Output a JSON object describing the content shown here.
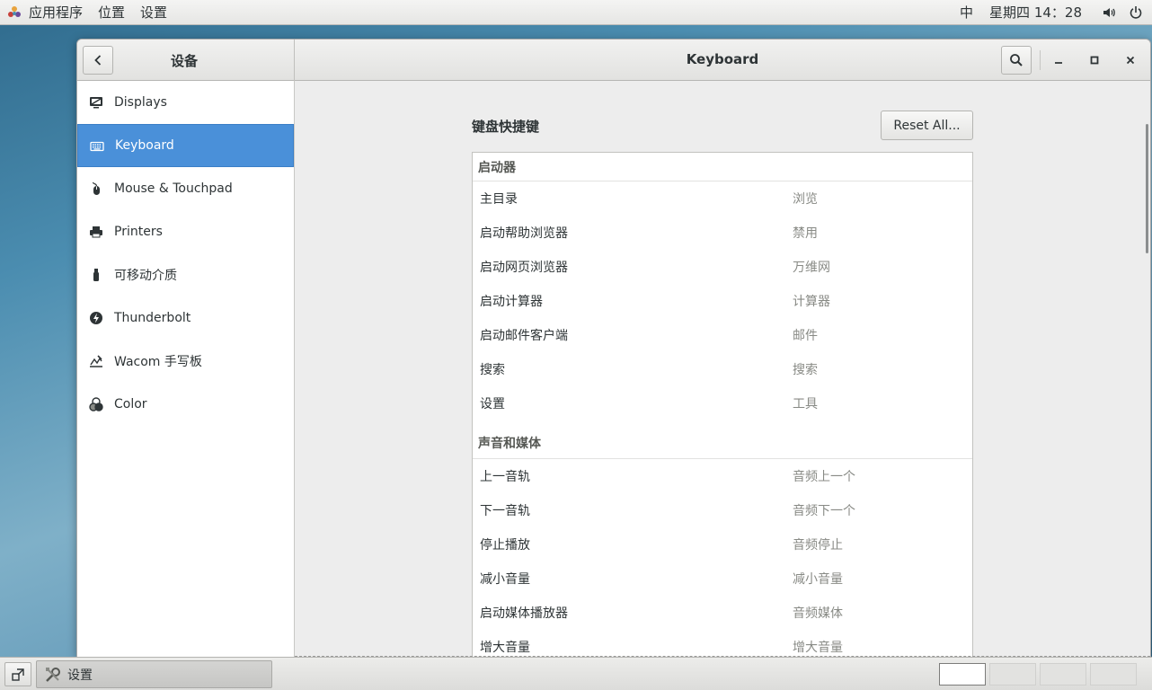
{
  "topbar": {
    "apps_menu": "应用程序",
    "places_menu": "位置",
    "settings_menu": "设置",
    "input_method": "中",
    "datetime": "星期四 14：28"
  },
  "window": {
    "sidebar_title": "设备",
    "page_title": "Keyboard"
  },
  "sidebar": {
    "items": [
      {
        "label": "Displays",
        "icon": "display-icon"
      },
      {
        "label": "Keyboard",
        "icon": "keyboard-icon",
        "active": true
      },
      {
        "label": "Mouse & Touchpad",
        "icon": "mouse-icon"
      },
      {
        "label": "Printers",
        "icon": "printer-icon"
      },
      {
        "label": "可移动介质",
        "icon": "usb-media-icon"
      },
      {
        "label": "Thunderbolt",
        "icon": "thunderbolt-icon"
      },
      {
        "label": "Wacom 手写板",
        "icon": "tablet-icon"
      },
      {
        "label": "Color",
        "icon": "color-icon"
      }
    ]
  },
  "shortcuts": {
    "section_title": "键盘快捷键",
    "reset_button": "Reset All...",
    "groups": [
      {
        "name": "启动器",
        "rows": [
          {
            "action": "主目录",
            "shortcut": "浏览"
          },
          {
            "action": "启动帮助浏览器",
            "shortcut": "禁用"
          },
          {
            "action": "启动网页浏览器",
            "shortcut": "万维网"
          },
          {
            "action": "启动计算器",
            "shortcut": "计算器"
          },
          {
            "action": "启动邮件客户端",
            "shortcut": "邮件"
          },
          {
            "action": "搜索",
            "shortcut": "搜索"
          },
          {
            "action": "设置",
            "shortcut": "工具"
          }
        ]
      },
      {
        "name": "声音和媒体",
        "rows": [
          {
            "action": "上一音轨",
            "shortcut": "音频上一个"
          },
          {
            "action": "下一音轨",
            "shortcut": "音频下一个"
          },
          {
            "action": "停止播放",
            "shortcut": "音频停止"
          },
          {
            "action": "减小音量",
            "shortcut": "减小音量"
          },
          {
            "action": "启动媒体播放器",
            "shortcut": "音频媒体"
          },
          {
            "action": "增大音量",
            "shortcut": "增大音量"
          }
        ]
      }
    ]
  },
  "taskbar": {
    "task_label": "设置",
    "workspaces": 4,
    "active_workspace": 1
  },
  "colors": {
    "accent": "#4a90d9",
    "sidebar_bg": "#ffffff",
    "content_bg": "#ededed",
    "dim_text": "#888a85"
  }
}
